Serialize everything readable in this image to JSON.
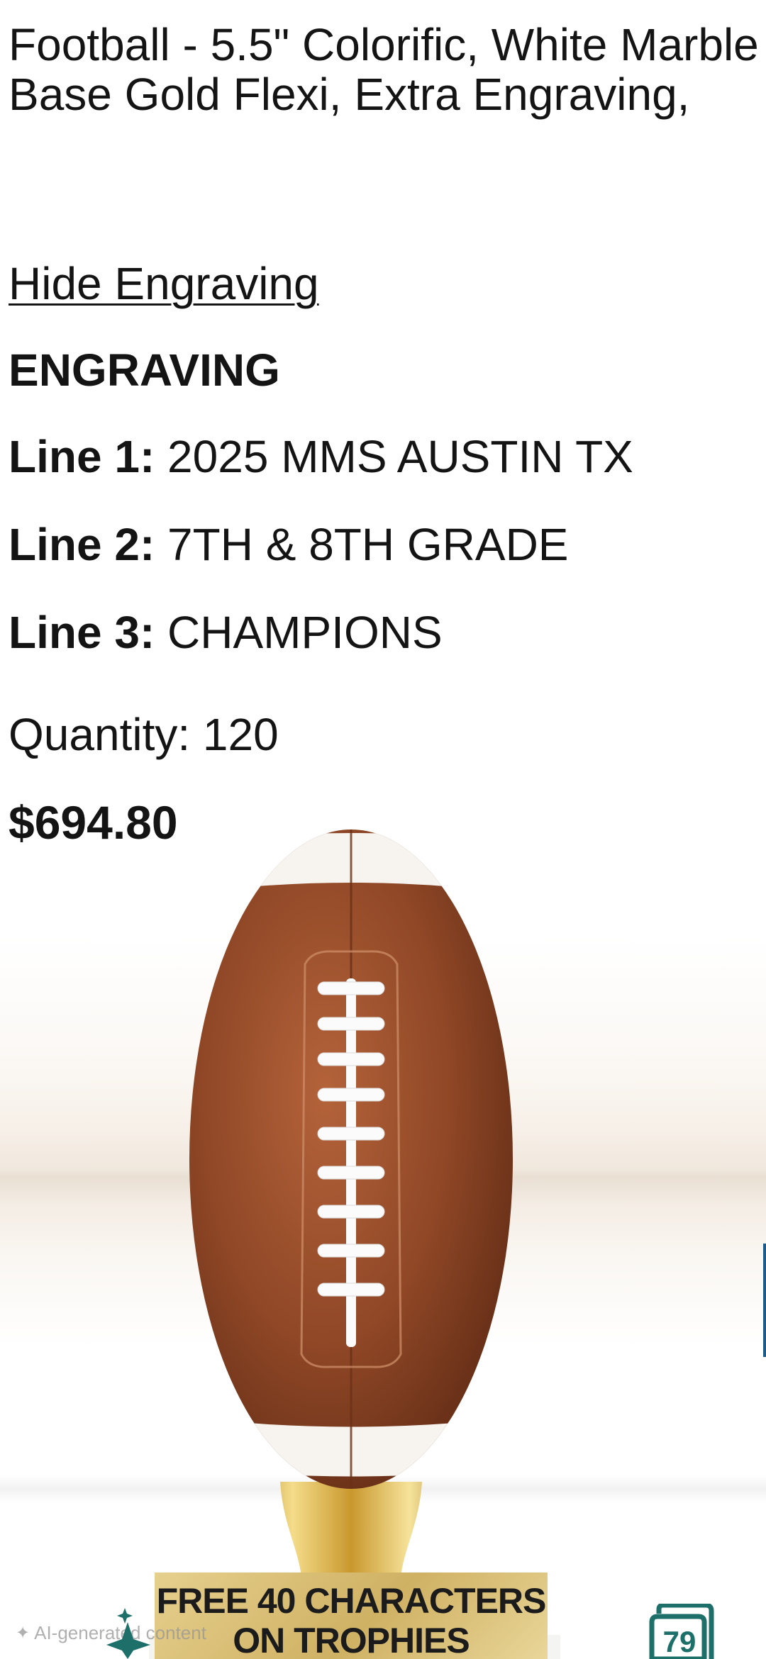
{
  "product": {
    "title": "Football - 5.5\" Colorific, White Marble Base Gold Flexi, Extra Engraving,",
    "hide_engraving_link": "Hide Engraving",
    "engraving_heading": "ENGRAVING",
    "engraving_lines": [
      {
        "label": "Line 1:",
        "value": "2025 MMS AUSTIN TX"
      },
      {
        "label": "Line 2:",
        "value": "7TH & 8TH GRADE"
      },
      {
        "label": "Line 3:",
        "value": "CHAMPIONS"
      }
    ],
    "quantity_text": "Quantity: 120",
    "price": "$694.80"
  },
  "image": {
    "plaque_line_1": "FREE 40 CHARACTERS",
    "plaque_line_2": "ON TROPHIES"
  },
  "overlay": {
    "watermark": "AI-generated content",
    "badge_count": "79"
  },
  "icons": {
    "watermark_icon": "ai-sparkle-icon",
    "assistant_icon": "sparkle-icon",
    "badge_icon": "tabs-counter-icon"
  },
  "colors": {
    "text": "#141414",
    "football_brown": "#8a4526",
    "gold": "#d8b24a",
    "plaque_gold": "#d9c079",
    "badge_teal": "#1d6f6a"
  }
}
